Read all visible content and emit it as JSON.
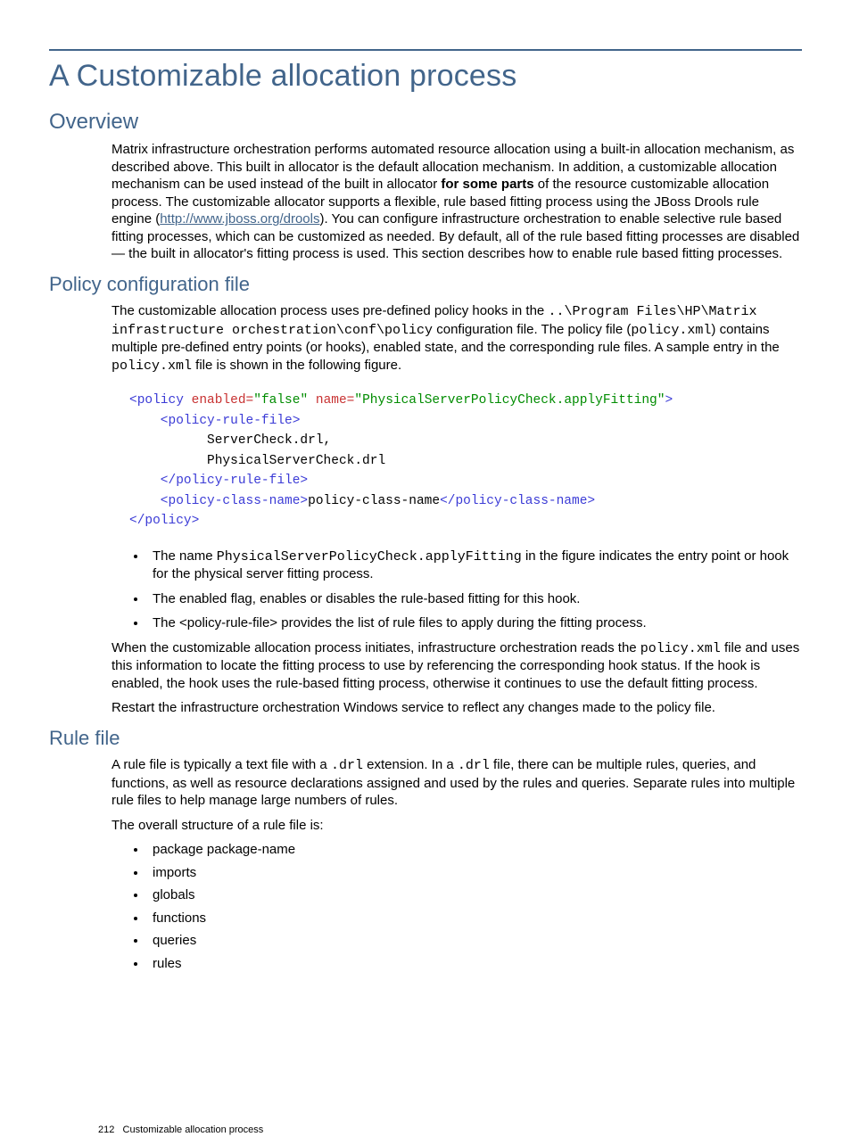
{
  "page_title": "A Customizable allocation process",
  "sections": {
    "overview": {
      "heading": "Overview",
      "para1_a": "Matrix infrastructure orchestration performs automated resource allocation using a built-in allocation mechanism, as described above. This built in allocator is the default allocation mechanism. In addition, a customizable allocation mechanism can be used instead of the built in allocator ",
      "bold1": "for some parts",
      "para1_b": " of the resource customizable allocation process. The customizable allocator supports a flexible, rule based fitting process using the JBoss Drools rule engine (",
      "link1_text": "http://www.jboss.org/drools",
      "para1_c": "). You can configure infrastructure orchestration to enable selective rule based fitting processes, which can be customized as needed. By default, all of the rule based fitting processes are disabled — the built in allocator's fitting process is used. This section describes how to enable rule based fitting processes."
    },
    "policy": {
      "heading": "Policy configuration file",
      "para1_a": "The customizable allocation process uses pre-defined policy hooks in the ",
      "mono1": "..\\Program Files\\HP\\Matrix infrastructure orchestration\\conf\\policy",
      "para1_b": " configuration file. The policy file (",
      "mono2": "policy.xml",
      "para1_c": ") contains multiple pre-defined entry points (or hooks), enabled state, and the corresponding rule files. A sample entry in the ",
      "mono3": "policy.xml",
      "para1_d": " file is shown in the following figure.",
      "code": {
        "l1_open": "<policy",
        "l1_attr1": " enabled=",
        "l1_val1": "\"false\"",
        "l1_attr2": " name=",
        "l1_val2": "\"PhysicalServerPolicyCheck.applyFitting\"",
        "l1_close": ">",
        "l2": "    <policy-rule-file>",
        "l3": "          ServerCheck.drl,",
        "l4": "          PhysicalServerCheck.drl",
        "l5": "    </policy-rule-file>",
        "l6a": "    <policy-class-name>",
        "l6b": "policy-class-name",
        "l6c": "</policy-class-name>",
        "l7": "</policy>"
      },
      "bullets": {
        "b1_a": "The name ",
        "b1_mono": "PhysicalServerPolicyCheck.applyFitting",
        "b1_b": " in the figure indicates the entry point or hook for the physical server fitting process.",
        "b2": "The enabled flag, enables or disables the rule-based fitting for this hook.",
        "b3": "The <policy-rule-file> provides the list of rule files to apply during the fitting process."
      },
      "para2_a": "When the customizable allocation process initiates, infrastructure orchestration reads the ",
      "para2_mono": "policy.xml",
      "para2_b": " file and uses this information to locate the fitting process to use by referencing the corresponding hook status. If the hook is enabled, the hook uses the rule-based fitting process, otherwise it continues to use the default fitting process.",
      "para3": "Restart the infrastructure orchestration Windows service to reflect any changes made to the policy file."
    },
    "rulefile": {
      "heading": "Rule file",
      "para1_a": "A rule file is typically a text file with a ",
      "mono1": ".drl",
      "para1_b": " extension. In a ",
      "mono2": ".drl",
      "para1_c": " file, there can be multiple rules, queries, and functions, as well as resource declarations assigned and used by the rules and queries. Separate rules into multiple rule files to help manage large numbers of rules.",
      "para2": "The overall structure of a rule file is:",
      "items": [
        "package package-name",
        "imports",
        "globals",
        "functions",
        "queries",
        "rules"
      ]
    }
  },
  "footer": {
    "page_num": "212",
    "title": "Customizable allocation process"
  }
}
